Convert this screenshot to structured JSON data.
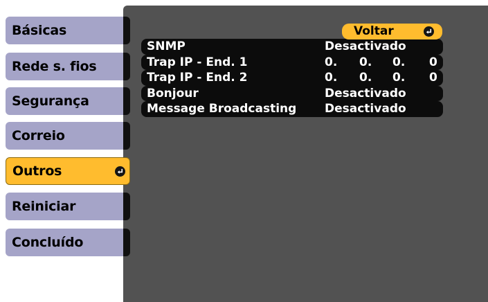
{
  "menu": {
    "items": [
      {
        "label": "Básicas"
      },
      {
        "label": "Rede s. fios"
      },
      {
        "label": "Segurança"
      },
      {
        "label": "Correio"
      },
      {
        "label": "Outros",
        "active": true
      },
      {
        "label": "Reiniciar"
      },
      {
        "label": "Concluído"
      }
    ]
  },
  "panel": {
    "back_label": "Voltar",
    "rows": [
      {
        "label": "SNMP",
        "value": "Desactivado"
      },
      {
        "label": "Trap IP - End. 1",
        "ip": [
          "0.",
          "0.",
          "0.",
          "0"
        ]
      },
      {
        "label": "Trap IP - End. 2",
        "ip": [
          "0.",
          "0.",
          "0.",
          "0"
        ]
      },
      {
        "label": "Bonjour",
        "value": "Desactivado"
      },
      {
        "label": "Message Broadcasting",
        "value": "Desactivado"
      }
    ]
  },
  "colors": {
    "menu_tab": "#a5a4c8",
    "active_highlight": "#ffbc2e",
    "panel_background": "#525252",
    "row_background": "#0c0c0c"
  },
  "icons": {
    "enter": "enter-return-icon"
  }
}
